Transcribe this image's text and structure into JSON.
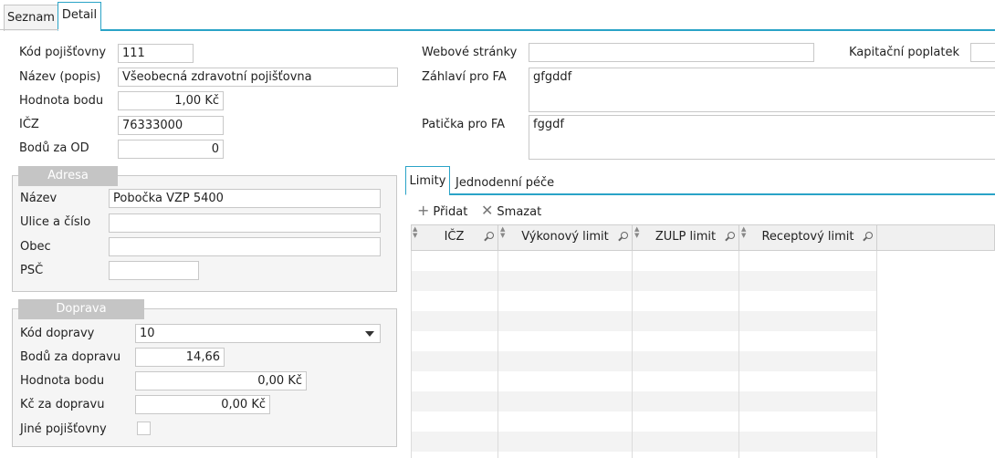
{
  "top_tabs": [
    {
      "label": "Seznam"
    },
    {
      "label": "Detail"
    }
  ],
  "insurer": {
    "kod_label": "Kód pojišťovny",
    "kod_value": "111",
    "nazev_label": "Název (popis)",
    "nazev_value": "Všeobecná zdravotní pojišťovna",
    "hodnota_label": "Hodnota bodu",
    "hodnota_value": "1,00 Kč",
    "icz_label": "IČZ",
    "icz_value": "76333000",
    "body_od_label": "Bodů za OD",
    "body_od_value": "0"
  },
  "right": {
    "web_label": "Webové stránky",
    "web_value": "",
    "kapitacni_label": "Kapitační poplatek",
    "kapitacni_value": "",
    "zahlavi_label": "Záhlaví pro FA",
    "zahlavi_value": "gfgddf",
    "paticka_label": "Patička pro FA",
    "paticka_value": "fggdf"
  },
  "adresa": {
    "title": "Adresa",
    "nazev_label": "Název",
    "nazev_value": "Pobočka VZP 5400",
    "ulice_label": "Ulice a číslo",
    "ulice_value": "",
    "obec_label": "Obec",
    "obec_value": "",
    "psc_label": "PSČ",
    "psc_value": ""
  },
  "doprava": {
    "title": "Doprava",
    "kod_label": "Kód dopravy",
    "kod_value": "10",
    "body_label": "Bodů za dopravu",
    "body_value": "14,66",
    "hodnota_label": "Hodnota bodu",
    "hodnota_value": "0,00 Kč",
    "kc_label": "Kč za dopravu",
    "kc_value": "0,00 Kč",
    "jine_label": "Jiné pojišťovny",
    "jine_checked": false
  },
  "sub_tabs": [
    {
      "label": "Limity"
    },
    {
      "label": "Jednodenní péče"
    }
  ],
  "toolbar": {
    "add_label": "Přidat",
    "delete_label": "Smazat",
    "add_icon": "plus-icon",
    "delete_icon": "x-icon"
  },
  "grid": {
    "columns": [
      {
        "label": "IČZ"
      },
      {
        "label": "Výkonový limit"
      },
      {
        "label": "ZULP limit"
      },
      {
        "label": "Receptový limit"
      }
    ],
    "rows": []
  },
  "colors": {
    "accent": "#2aa3c7",
    "legend_bg": "#c5c5c5",
    "group_bg": "#f5f5f5"
  }
}
